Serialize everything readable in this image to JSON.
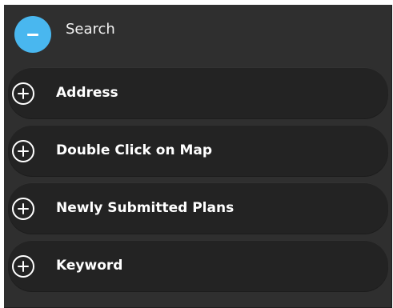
{
  "header": {
    "toggle_icon": "minus-circle-icon",
    "label": "Search",
    "accent_color": "#49b7ef"
  },
  "items": [
    {
      "icon": "plus-circle-icon",
      "label": "Address"
    },
    {
      "icon": "plus-circle-icon",
      "label": "Double Click on Map"
    },
    {
      "icon": "plus-circle-icon",
      "label": "Newly Submitted Plans"
    },
    {
      "icon": "plus-circle-icon",
      "label": "Keyword"
    }
  ]
}
